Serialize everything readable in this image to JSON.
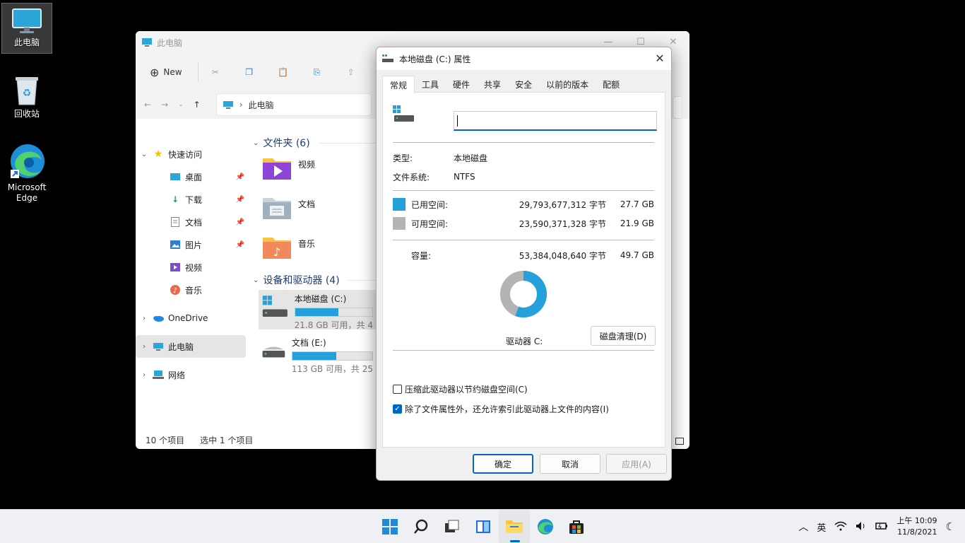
{
  "desktop": {
    "icons": [
      {
        "label": "此电脑"
      },
      {
        "label": "回收站"
      },
      {
        "label": "Microsoft Edge"
      }
    ]
  },
  "explorer": {
    "title": "此电脑",
    "toolbar": {
      "new_label": "New"
    },
    "address": {
      "path": "此电脑"
    },
    "nav": {
      "quick_access": "快速访问",
      "items": [
        {
          "label": "桌面"
        },
        {
          "label": "下载"
        },
        {
          "label": "文档"
        },
        {
          "label": "图片"
        },
        {
          "label": "视频"
        },
        {
          "label": "音乐"
        }
      ],
      "onedrive": "OneDrive",
      "this_pc": "此电脑",
      "network": "网络"
    },
    "folders_header": "文件夹 (6)",
    "folders": [
      {
        "label": "视频"
      },
      {
        "label": "文档"
      },
      {
        "label": "音乐"
      }
    ],
    "drives_header": "设备和驱动器 (4)",
    "drives": [
      {
        "label": "本地磁盘 (C:)",
        "free_text": "21.8 GB 可用，共 4",
        "used_fraction": 0.56
      },
      {
        "label": "文档 (E:)",
        "free_text": "113 GB 可用，共 25",
        "used_fraction": 0.55
      }
    ],
    "status": {
      "count": "10 个项目",
      "selected": "选中 1 个项目"
    }
  },
  "dialog": {
    "title": "本地磁盘 (C:) 属性",
    "tabs": [
      "常规",
      "工具",
      "硬件",
      "共享",
      "安全",
      "以前的版本",
      "配额"
    ],
    "volume_name_value": "",
    "type_label": "类型:",
    "type_value": "本地磁盘",
    "fs_label": "文件系统:",
    "fs_value": "NTFS",
    "used": {
      "label": "已用空间:",
      "bytes": "29,793,677,312 字节",
      "gb": "27.7 GB",
      "color": "#26a0da"
    },
    "free": {
      "label": "可用空间:",
      "bytes": "23,590,371,328 字节",
      "gb": "21.9 GB",
      "color": "#b4b4b4"
    },
    "capacity": {
      "label": "容量:",
      "bytes": "53,384,048,640 字节",
      "gb": "49.7 GB"
    },
    "used_fraction": 0.558,
    "drive_label": "驱动器 C:",
    "cleanup_button": "磁盘清理(D)",
    "compress_label": "压缩此驱动器以节约磁盘空间(C)",
    "compress_checked": false,
    "index_label": "除了文件属性外，还允许索引此驱动器上文件的内容(I)",
    "index_checked": true,
    "ok_button": "确定",
    "cancel_button": "取消",
    "apply_button": "应用(A)"
  },
  "taskbar": {
    "ime": "英",
    "time": "上午 10:09",
    "date": "11/8/2021"
  }
}
